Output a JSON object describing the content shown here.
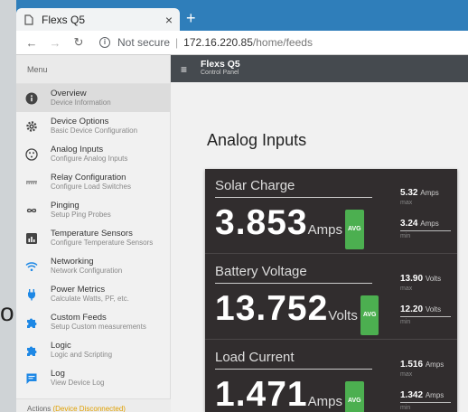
{
  "browser": {
    "tab_title": "Flexs Q5",
    "tab_close": "×",
    "new_tab": "+",
    "secure_label": "Not secure",
    "url_host": "172.16.220.85",
    "url_path": "/home/feeds"
  },
  "sidebar": {
    "header": "Menu",
    "items": [
      {
        "title": "Overview",
        "sub": "Device Information",
        "icon": "info-icon",
        "active": true
      },
      {
        "title": "Device Options",
        "sub": "Basic Device Configuration",
        "icon": "gear-icon"
      },
      {
        "title": "Analog Inputs",
        "sub": "Configure Analog Inputs",
        "icon": "analog-input-icon"
      },
      {
        "title": "Relay Configuration",
        "sub": "Configure Load Switches",
        "icon": "relay-icon"
      },
      {
        "title": "Pinging",
        "sub": "Setup Ping Probes",
        "icon": "infinity-icon"
      },
      {
        "title": "Temperature Sensors",
        "sub": "Configure Temperature Sensors",
        "icon": "chart-icon"
      },
      {
        "title": "Networking",
        "sub": "Network Configuration",
        "icon": "wifi-icon"
      },
      {
        "title": "Power Metrics",
        "sub": "Calculate Watts, PF, etc.",
        "icon": "plug-icon"
      },
      {
        "title": "Custom Feeds",
        "sub": "Setup Custom measurements",
        "icon": "puzzle-icon"
      },
      {
        "title": "Logic",
        "sub": "Logic and Scripting",
        "icon": "puzzle-icon"
      },
      {
        "title": "Log",
        "sub": "View Device Log",
        "icon": "message-icon"
      }
    ],
    "actions_label": "Actions",
    "actions_status": "(Device Disconnected)"
  },
  "header": {
    "title": "Flexs Q5",
    "subtitle": "Control Panel"
  },
  "page": {
    "heading": "Analog Inputs"
  },
  "cards": [
    {
      "name": "Solar Charge",
      "value": "3.853",
      "unit": "Amps",
      "avg": "AVG",
      "max_value": "5.32",
      "max_unit": "Amps",
      "max_label": "max",
      "min_value": "3.24",
      "min_unit": "Amps",
      "min_label": "min"
    },
    {
      "name": "Battery Voltage",
      "value": "13.752",
      "unit": "Volts",
      "avg": "AVG",
      "max_value": "13.90",
      "max_unit": "Volts",
      "max_label": "max",
      "min_value": "12.20",
      "min_unit": "Volts",
      "min_label": "min"
    },
    {
      "name": "Load Current",
      "value": "1.471",
      "unit": "Amps",
      "avg": "AVG",
      "max_value": "1.516",
      "max_unit": "Amps",
      "max_label": "max",
      "min_value": "1.342",
      "min_unit": "Amps",
      "min_label": "min"
    }
  ],
  "background_text": "oı",
  "colors": {
    "accent": "#2f7eba",
    "header": "#454a4f",
    "card": "#312d2e",
    "icon_blue": "#1e88e5",
    "avg_green": "#4caf50",
    "warning": "#e0a000"
  }
}
